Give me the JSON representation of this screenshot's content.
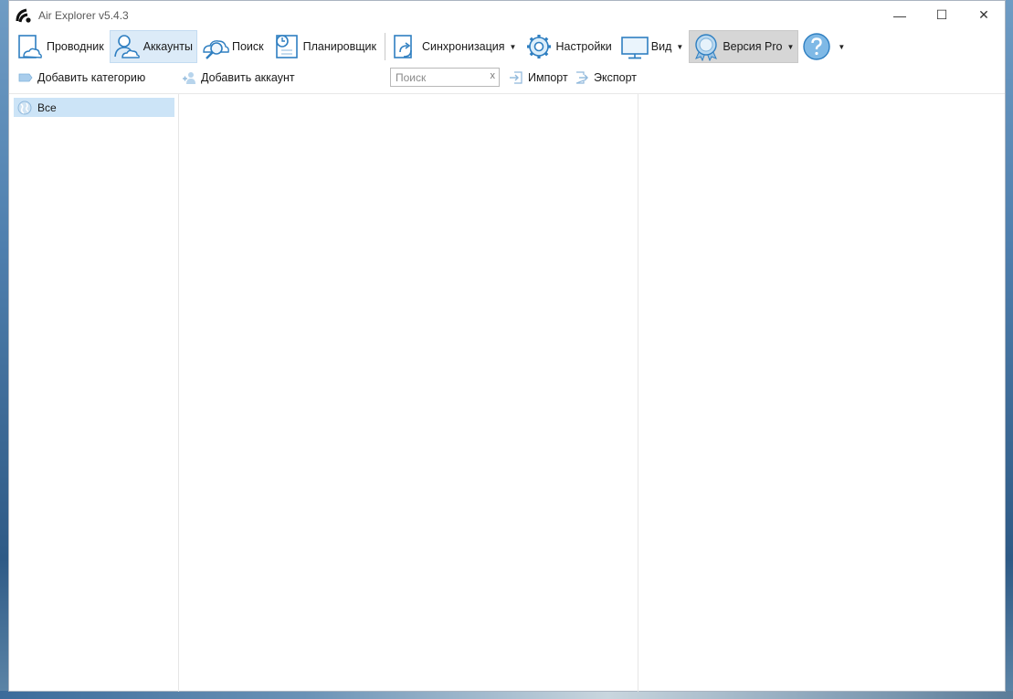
{
  "window": {
    "title": "Air Explorer v5.4.3",
    "controls": {
      "minimize": "—",
      "maximize": "☐",
      "close": "✕"
    }
  },
  "toolbar": {
    "explorer": "Проводник",
    "accounts": "Аккаунты",
    "search": "Поиск",
    "scheduler": "Планировщик",
    "sync": "Синхронизация",
    "settings": "Настройки",
    "view": "Вид",
    "pro": "Версия Pro",
    "dropdown_glyph": "▼"
  },
  "subbar": {
    "add_category": "Добавить категорию",
    "add_account": "Добавить аккаунт",
    "search_placeholder": "Поиск",
    "search_clear": "x",
    "import": "Импорт",
    "export": "Экспорт"
  },
  "categories": {
    "items": [
      {
        "label": "Все",
        "selected": true
      }
    ]
  },
  "colors": {
    "accent": "#2f7fc1",
    "selected_bg": "#cce4f7",
    "active_tab_bg": "#dcebf8",
    "pro_bg": "#d6d6d6"
  }
}
